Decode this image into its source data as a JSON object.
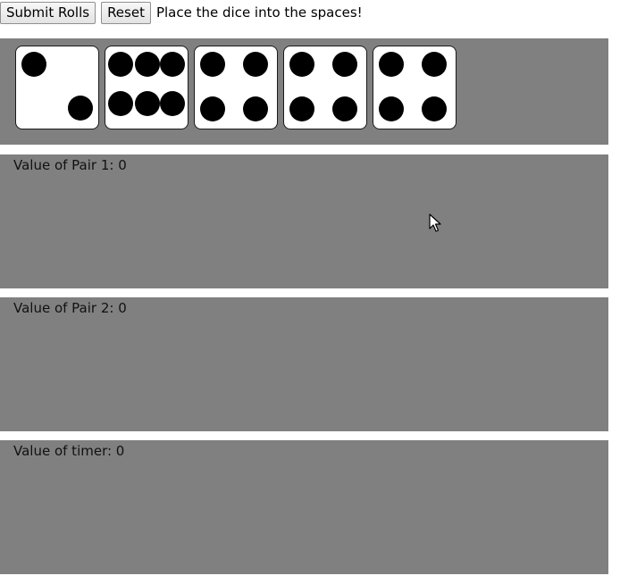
{
  "toolbar": {
    "submit_label": "Submit Rolls",
    "reset_label": "Reset",
    "instruction": "Place the dice into the spaces!"
  },
  "dice": [
    {
      "value": 2
    },
    {
      "value": 6
    },
    {
      "value": 4
    },
    {
      "value": 4
    },
    {
      "value": 4
    }
  ],
  "panels": {
    "pair1_label": "Value of Pair 1: 0",
    "pair2_label": "Value of Pair 2: 0",
    "timer_label": "Value of timer: 0"
  },
  "colors": {
    "panel_bg": "#808080",
    "die_face": "#ffffff",
    "pip": "#000000"
  }
}
